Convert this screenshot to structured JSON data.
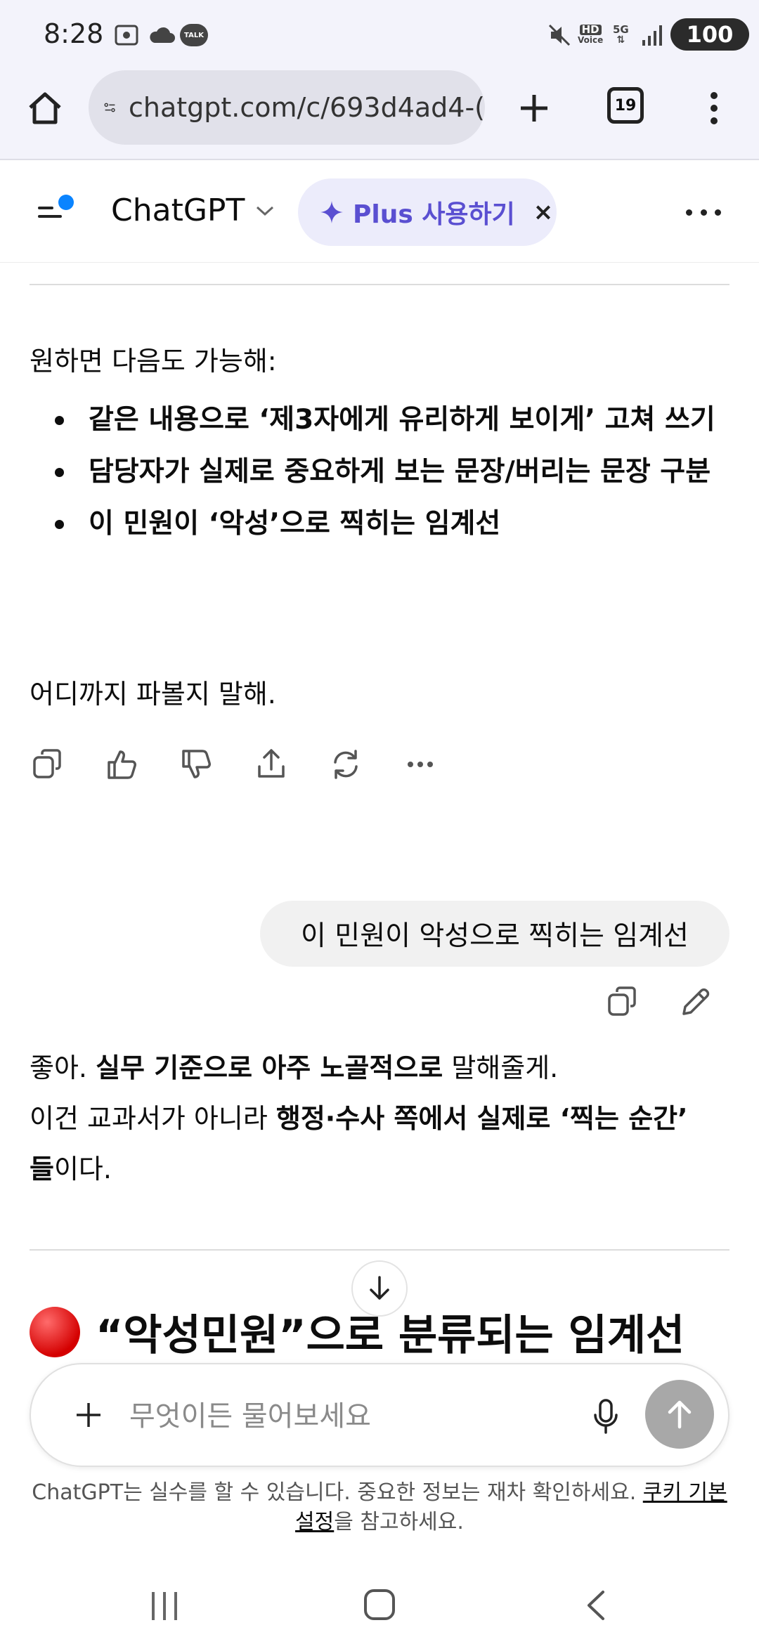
{
  "status_bar": {
    "time": "8:28",
    "talk_label": "TALK",
    "hd_label": "HD",
    "voice_label": "Voice",
    "fiveg_label": "5G",
    "battery": "100"
  },
  "browser": {
    "url": "chatgpt.com/c/693d4ad4-(",
    "tab_count": "19"
  },
  "header": {
    "title": "ChatGPT",
    "plus_label": "Plus 사용하기",
    "plus_close": "×"
  },
  "assistant_msg_1": {
    "intro": "원하면 다음도 가능해:",
    "bullets": [
      "같은 내용으로 ‘제3자에게 유리하게 보이게’ 고쳐 쓰기",
      "담당자가 실제로 중요하게 보는 문장/버리는 문장 구분",
      "이 민원이 ‘악성’으로 찍히는 임계선"
    ],
    "closing": "어디까지 파볼지 말해."
  },
  "user_msg": {
    "text": "이 민원이 악성으로 찍히는 임계선"
  },
  "assistant_msg_2": {
    "line1_a": "좋아. ",
    "line1_b": "실무 기준으로 아주 노골적으로",
    "line1_c": " 말해줄게.",
    "line2_a": "이건 교과서가 아니라 ",
    "line2_b": "행정·수사 쪽에서 실제로 ‘찍는 순간’",
    "line3_a": "들",
    "line3_b": "이다.",
    "heading": "“악성민원”으로 분류되는 임계선"
  },
  "composer": {
    "placeholder": "무엇이든 물어보세요"
  },
  "disclaimer": {
    "text": "ChatGPT는 실수를 할 수 있습니다. 중요한 정보는 재차 확인하세요. ",
    "link1": "쿠키 기본",
    "link2": "설정",
    "tail": "을 참고하세요."
  },
  "colors": {
    "accent": "#5a4fd1",
    "notification_dot": "#0a84ff",
    "heading_dot": "#d40000"
  }
}
